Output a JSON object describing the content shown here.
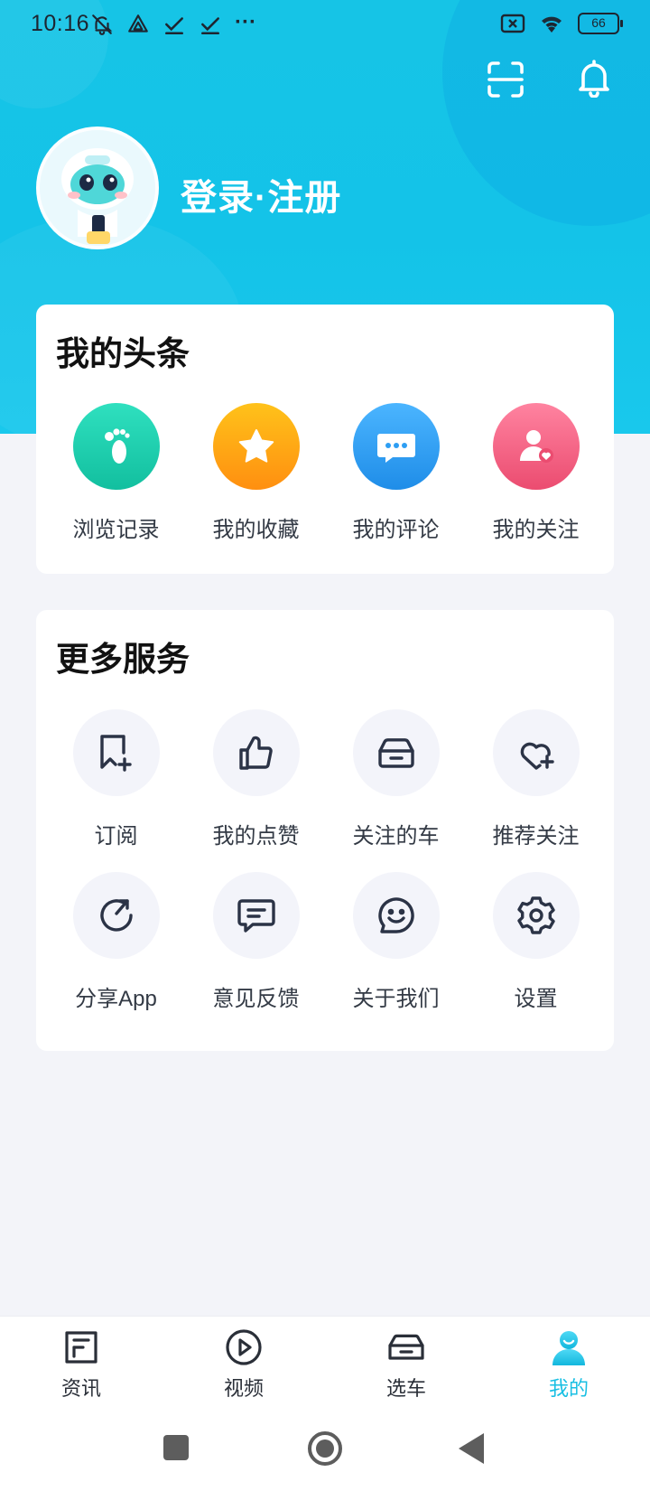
{
  "status_bar": {
    "time": "10:16",
    "more": "···",
    "battery": "66"
  },
  "profile": {
    "login_label": "登录·注册"
  },
  "my_headlines": {
    "title": "我的头条",
    "items": [
      {
        "label": "浏览记录",
        "icon": "footprint-icon",
        "color": "#1ccdab"
      },
      {
        "label": "我的收藏",
        "icon": "star-icon",
        "color": "#ffa812"
      },
      {
        "label": "我的评论",
        "icon": "comment-icon",
        "color": "#2d9ef3"
      },
      {
        "label": "我的关注",
        "icon": "user-heart-icon",
        "color": "#f2607f"
      }
    ]
  },
  "more_services": {
    "title": "更多服务",
    "items": [
      {
        "label": "订阅",
        "icon": "bookmark-plus-icon"
      },
      {
        "label": "我的点赞",
        "icon": "thumbs-up-icon"
      },
      {
        "label": "关注的车",
        "icon": "car-icon"
      },
      {
        "label": "推荐关注",
        "icon": "heart-plus-icon"
      },
      {
        "label": "分享App",
        "icon": "share-refresh-icon"
      },
      {
        "label": "意见反馈",
        "icon": "feedback-icon"
      },
      {
        "label": "关于我们",
        "icon": "smile-icon"
      },
      {
        "label": "设置",
        "icon": "gear-icon"
      }
    ]
  },
  "bottom_nav": {
    "items": [
      {
        "label": "资讯",
        "icon": "news-icon",
        "active": false
      },
      {
        "label": "视频",
        "icon": "play-icon",
        "active": false
      },
      {
        "label": "选车",
        "icon": "car-nav-icon",
        "active": false
      },
      {
        "label": "我的",
        "icon": "profile-icon",
        "active": true
      }
    ],
    "active_color": "#18bfe3"
  },
  "colors": {
    "header_bg": "#16c4e6",
    "page_bg": "#f3f4f9",
    "icon_dark": "#2b3346"
  }
}
